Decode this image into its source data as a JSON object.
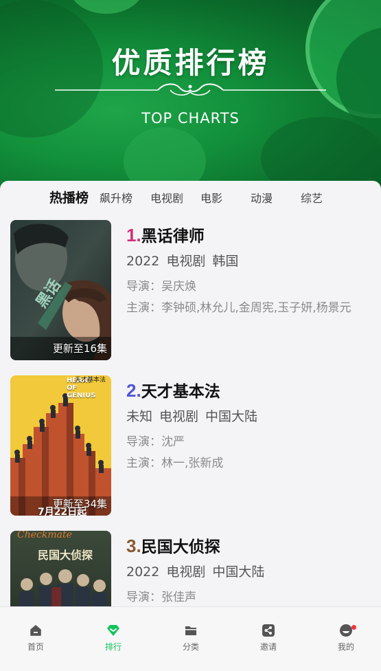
{
  "hero": {
    "title": "优质排行榜",
    "subtitle": "TOP CHARTS"
  },
  "tabs": [
    "热播榜",
    "飙升榜",
    "电视剧",
    "电影",
    "动漫",
    "综艺"
  ],
  "active_tab": "热播榜",
  "list": [
    {
      "rank": "1.",
      "rank_color": "#d12f7a",
      "title": "黑话律师",
      "year": "2022",
      "type": "电视剧",
      "region": "韩国",
      "director": "导演：吴庆焕",
      "cast": "主演：李钟硕,林允儿,金周宪,玉子妍,杨景元",
      "episode": "更新至16集",
      "poster_text": "黑话"
    },
    {
      "rank": "2.",
      "rank_color": "#4f55d6",
      "title": "天才基本法",
      "year": "未知",
      "type": "电视剧",
      "region": "中国大陆",
      "director": "导演：沈严",
      "cast": "主演：林一,张新成",
      "episode": "更新至34集",
      "poster_title": "HEART OF GENIUS",
      "poster_tag": "天才基本法",
      "poster_date": "7月22日起"
    },
    {
      "rank": "3.",
      "rank_color": "#8a5a32",
      "title": "民国大侦探",
      "year": "2022",
      "type": "电视剧",
      "region": "中国大陆",
      "director": "导演：张佳声",
      "cast": "",
      "poster_script": "Checkmate",
      "poster_title": "民国大侦探"
    }
  ],
  "tabbar": [
    {
      "label": "首页",
      "icon": "home-icon"
    },
    {
      "label": "排行",
      "icon": "ranking-icon",
      "active": true
    },
    {
      "label": "分类",
      "icon": "folder-icon"
    },
    {
      "label": "邀请",
      "icon": "share-icon"
    },
    {
      "label": "我的",
      "icon": "profile-icon",
      "badge": true
    }
  ],
  "colors": {
    "accent": "#16c25c",
    "hero_green": "#12903b",
    "badge_red": "#f0383a"
  }
}
